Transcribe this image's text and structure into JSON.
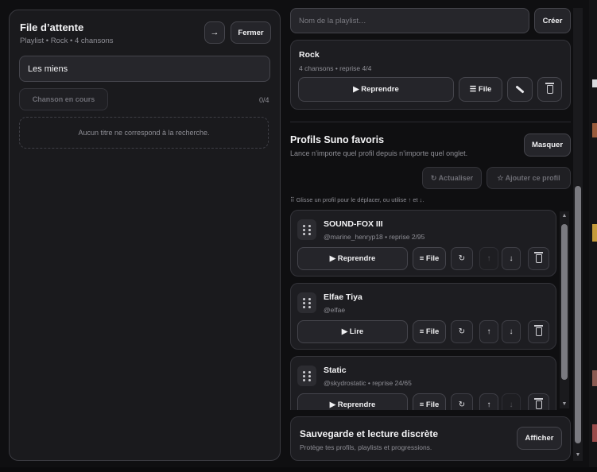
{
  "queue": {
    "title": "File d’attente",
    "subtitle": "Playlist • Rock • 4 chansons",
    "arrow_label": "→",
    "close_label": "Fermer",
    "search_value": "Les miens",
    "current_song_label": "Chanson en cours",
    "counter": "0/4",
    "empty_message": "Aucun titre ne correspond à la recherche."
  },
  "playlist": {
    "name_placeholder": "Nom de la playlist…",
    "create_label": "Créer",
    "card": {
      "title": "Rock",
      "meta": "4 chansons • reprise 4/4",
      "resume_label": "▶ Reprendre",
      "queue_label": "☰ File"
    }
  },
  "profiles": {
    "title": "Profils Suno favoris",
    "subtitle": "Lance n’importe quel profil depuis n’importe quel onglet.",
    "hide_label": "Masquer",
    "refresh_label": "↻ Actualiser",
    "add_label": "☆ Ajouter ce profil",
    "hint": "⠿ Glisse un profil pour le déplacer, ou utilise ↑ et ↓.",
    "items": [
      {
        "name": "SOUND-FOX III",
        "meta": "@marine_henryp18 • reprise 2/95",
        "play_label": "▶ Reprendre",
        "queue_label": "≡ File"
      },
      {
        "name": "Elfae Tiya",
        "meta": "@elfae",
        "play_label": "▶ Lire",
        "queue_label": "≡ File"
      },
      {
        "name": "Static",
        "meta": "@skydrostatic • reprise 24/65",
        "play_label": "▶ Reprendre",
        "queue_label": "≡ File"
      }
    ]
  },
  "backup": {
    "title": "Sauvegarde et lecture discrète",
    "subtitle": "Protège tes profils, playlists et progressions.",
    "show_label": "Afficher"
  },
  "icons": {
    "refresh": "↻",
    "up": "↑",
    "down": "↓"
  },
  "colors": {
    "background": "#0f0f11",
    "panel": "#1a1a1d",
    "border": "#3a3a40"
  }
}
